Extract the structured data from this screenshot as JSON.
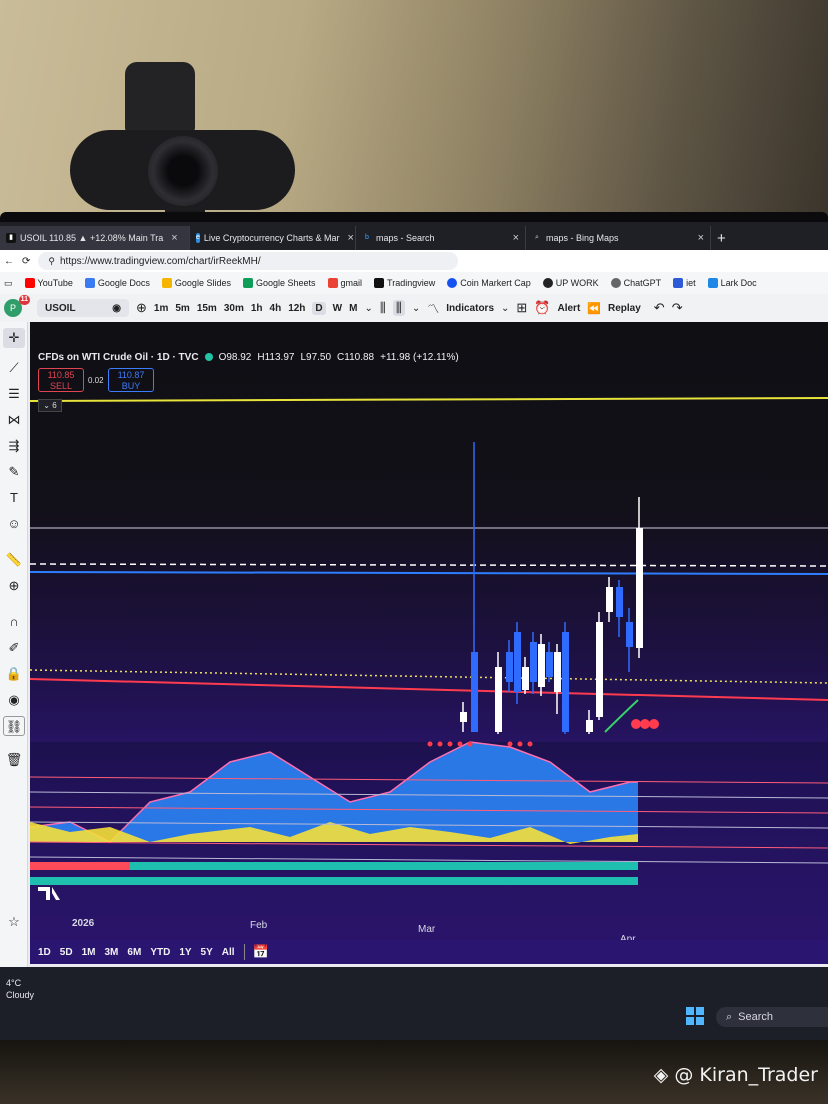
{
  "browser": {
    "tabs": [
      {
        "label": "USOIL 110.85 ▲ +12.08% Main Tra",
        "active": true
      },
      {
        "label": "Live Cryptocurrency Charts & Mar",
        "active": false
      },
      {
        "label": "maps - Search",
        "active": false
      },
      {
        "label": "maps - Bing Maps",
        "active": false
      }
    ],
    "new_tab": "+",
    "url": "https://www.tradingview.com/chart/irReekMH/",
    "bookmarks": [
      "YouTube",
      "Google Docs",
      "Google Slides",
      "Google Sheets",
      "gmail",
      "Tradingview",
      "Coin Markert Cap",
      "UP WORK",
      "ChatGPT",
      "iet",
      "Lark Doc"
    ]
  },
  "toolbar": {
    "avatar_letter": "P",
    "avatar_badge": "11",
    "symbol": "USOIL",
    "timeframes": [
      "1m",
      "5m",
      "15m",
      "30m",
      "1h",
      "4h",
      "12h",
      "D",
      "W",
      "M"
    ],
    "selected_timeframe": "D",
    "indicators_label": "Indicators",
    "alert_label": "Alert",
    "replay_label": "Replay"
  },
  "chart": {
    "title": "CFDs on WTI Crude Oil · 1D · TVC",
    "open": "O98.92",
    "high": "H113.97",
    "low": "L97.50",
    "close": "C110.88",
    "change": "+11.98 (+12.11%)",
    "sell_price": "110.85",
    "sell_label": "SELL",
    "spread": "0.02",
    "buy_price": "110.87",
    "buy_label": "BUY",
    "collapse_count": "6",
    "time_labels": [
      "2026",
      "Feb",
      "Mar",
      "Apr"
    ],
    "ranges": [
      "1D",
      "5D",
      "1M",
      "3M",
      "6M",
      "YTD",
      "1Y",
      "5Y",
      "All"
    ],
    "colors": {
      "up": "#ffffff",
      "down": "#2f6bff",
      "level_yellow": "#e8e33a",
      "level_blue": "#2f7dff",
      "level_red": "#ff3b4f"
    }
  },
  "taskbar": {
    "temperature": "4°C",
    "condition": "Cloudy",
    "search_label": "Search"
  },
  "watermark": "@ Kiran_Trader"
}
